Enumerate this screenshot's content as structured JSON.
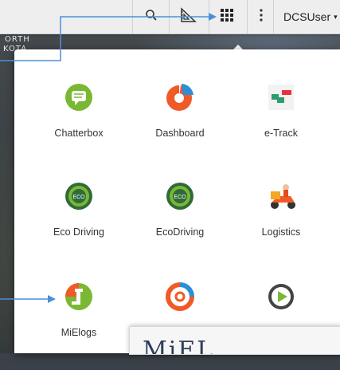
{
  "toolbar": {
    "user_label": "DCSUser",
    "icons": [
      "search-icon",
      "ruler-triangle-icon",
      "apps-grid-icon",
      "more-vertical-icon",
      "caret-down-icon"
    ]
  },
  "map": {
    "labels": [
      "ORTH",
      "KOTA"
    ]
  },
  "apps": [
    {
      "label": "Chatterbox",
      "icon": "chat-bubble-icon"
    },
    {
      "label": "Dashboard",
      "icon": "dashboard-pie-icon"
    },
    {
      "label": "e-Track",
      "icon": "etrack-icon"
    },
    {
      "label": "Eco Driving",
      "icon": "eco-wheel-icon"
    },
    {
      "label": "EcoDriving",
      "icon": "eco-wheel-icon"
    },
    {
      "label": "Logistics",
      "icon": "delivery-scooter-icon"
    },
    {
      "label": "MiElogs",
      "icon": "mielogs-icon"
    },
    {
      "label": "",
      "icon": "gauge-icon"
    },
    {
      "label": "",
      "icon": "play-reel-icon"
    }
  ],
  "window2": {
    "title": "MiEL"
  },
  "colors": {
    "annotation": "#4a90d9",
    "green": "#7ab833",
    "orange": "#f05a28"
  }
}
